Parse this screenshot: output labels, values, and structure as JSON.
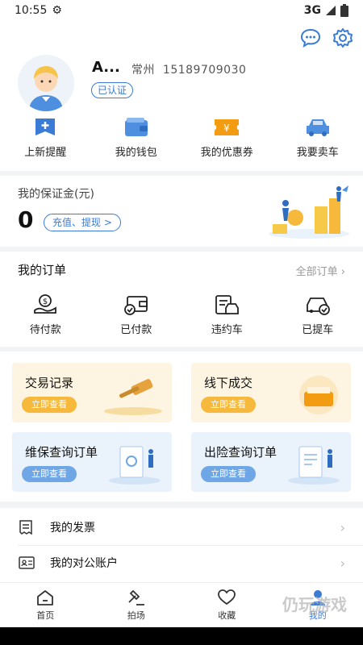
{
  "status": {
    "time": "10:55",
    "network": "3G"
  },
  "profile": {
    "name": "A...",
    "city": "常州",
    "phone": "15189709030",
    "verified": "已认证"
  },
  "quick_actions": [
    {
      "label": "上新提醒",
      "icon": "bell-plus-icon"
    },
    {
      "label": "我的钱包",
      "icon": "wallet-icon"
    },
    {
      "label": "我的优惠券",
      "icon": "coupon-icon"
    },
    {
      "label": "我要卖车",
      "icon": "car-icon"
    }
  ],
  "deposit": {
    "title": "我的保证金(元)",
    "amount": "0",
    "button": "充值、提现 >"
  },
  "orders": {
    "title": "我的订单",
    "all": "全部订单",
    "items": [
      {
        "label": "待付款",
        "icon": "money-hand-icon"
      },
      {
        "label": "已付款",
        "icon": "wallet-check-icon"
      },
      {
        "label": "违约车",
        "icon": "car-document-icon"
      },
      {
        "label": "已提车",
        "icon": "car-check-icon"
      }
    ]
  },
  "services": [
    {
      "label": "交易记录",
      "button": "立即查看"
    },
    {
      "label": "线下成交",
      "button": "立即查看"
    },
    {
      "label": "维保查询订单",
      "button": "立即查看"
    },
    {
      "label": "出险查询订单",
      "button": "立即查看"
    }
  ],
  "list": [
    {
      "label": "我的发票",
      "icon": "invoice-icon"
    },
    {
      "label": "我的对公账户",
      "icon": "id-card-icon"
    }
  ],
  "tabs": [
    {
      "label": "首页",
      "icon": "home-icon"
    },
    {
      "label": "拍场",
      "icon": "gavel-icon"
    },
    {
      "label": "收藏",
      "icon": "heart-icon"
    },
    {
      "label": "我的",
      "icon": "user-icon"
    }
  ],
  "watermark": "仍玩游戏",
  "colors": {
    "accent": "#3a7bd5",
    "yellow_card": "#fdf5e1",
    "blue_card": "#eaf2fb"
  }
}
